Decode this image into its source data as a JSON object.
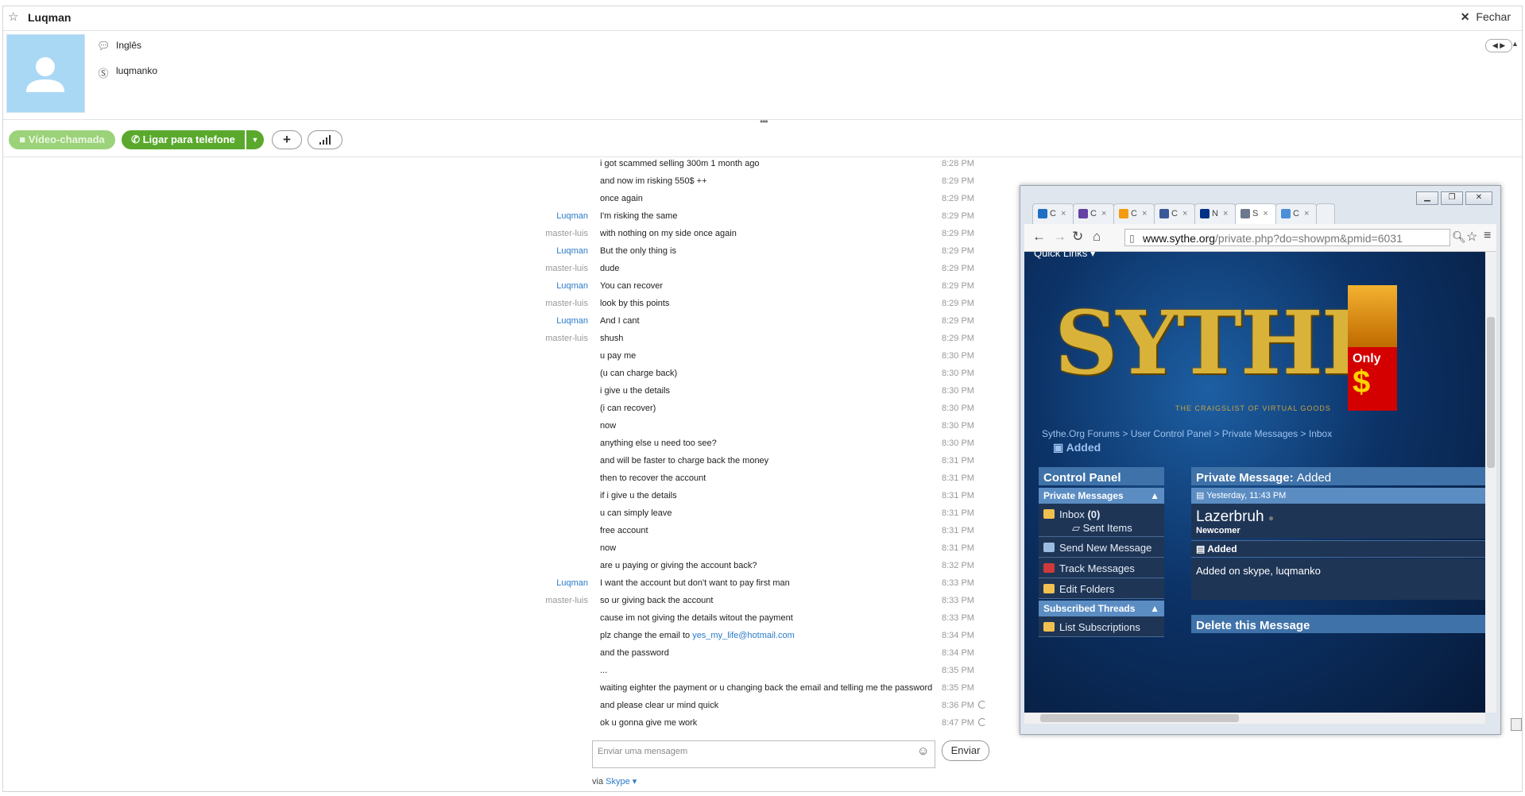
{
  "window": {
    "title": "Luqman",
    "close_label": "Fechar"
  },
  "profile": {
    "language": "Inglês",
    "skype_name": "luqmanko"
  },
  "call_bar": {
    "video_label": "Vídeo-chamada",
    "phone_label": "Ligar para telefone",
    "plus_label": "+"
  },
  "messages": [
    {
      "sender": "",
      "text": "i got scammed selling 300m 1 month ago",
      "time": "8:28 PM"
    },
    {
      "sender": "",
      "text": "and now im risking 550$ ++",
      "time": "8:29 PM"
    },
    {
      "sender": "",
      "text": "once again",
      "time": "8:29 PM"
    },
    {
      "sender": "Luqman",
      "text": "I'm risking the same",
      "time": "8:29 PM"
    },
    {
      "sender": "master-luis",
      "text": "with nothing on my side once again",
      "time": "8:29 PM"
    },
    {
      "sender": "Luqman",
      "text": "But the only thing is",
      "time": "8:29 PM"
    },
    {
      "sender": "master-luis",
      "text": "dude",
      "time": "8:29 PM"
    },
    {
      "sender": "Luqman",
      "text": "You can recover",
      "time": "8:29 PM"
    },
    {
      "sender": "master-luis",
      "text": "look by this points",
      "time": "8:29 PM"
    },
    {
      "sender": "Luqman",
      "text": "And I cant",
      "time": "8:29 PM"
    },
    {
      "sender": "master-luis",
      "text": "shush",
      "time": "8:29 PM"
    },
    {
      "sender": "",
      "text": "u pay me",
      "time": "8:30 PM"
    },
    {
      "sender": "",
      "text": "(u can charge back)",
      "time": "8:30 PM"
    },
    {
      "sender": "",
      "text": "i give u the details",
      "time": "8:30 PM"
    },
    {
      "sender": "",
      "text": "(i can recover)",
      "time": "8:30 PM"
    },
    {
      "sender": "",
      "text": "now",
      "time": "8:30 PM"
    },
    {
      "sender": "",
      "text": "anything else u need too  see?",
      "time": "8:30 PM"
    },
    {
      "sender": "",
      "text": "and will be faster to charge back the money",
      "time": "8:31 PM"
    },
    {
      "sender": "",
      "text": "then to recover the account",
      "time": "8:31 PM"
    },
    {
      "sender": "",
      "text": "if i give u the details",
      "time": "8:31 PM"
    },
    {
      "sender": "",
      "text": "u can simply leave",
      "time": "8:31 PM"
    },
    {
      "sender": "",
      "text": "free account",
      "time": "8:31 PM"
    },
    {
      "sender": "",
      "text": "now",
      "time": "8:31 PM"
    },
    {
      "sender": "",
      "text": "are u paying or giving the account back?",
      "time": "8:32 PM"
    },
    {
      "sender": "Luqman",
      "text": "I want the account but don't want to pay first man",
      "time": "8:33 PM"
    },
    {
      "sender": "master-luis",
      "text": "so ur giving back the account",
      "time": "8:33 PM"
    },
    {
      "sender": "",
      "text": "cause im not giving the details witout the payment",
      "time": "8:33 PM"
    },
    {
      "sender": "",
      "text": "plz change the email to ",
      "link": "yes_my_life@hotmail.com",
      "time": "8:34 PM"
    },
    {
      "sender": "",
      "text": "and the password",
      "time": "8:34 PM"
    },
    {
      "sender": "",
      "text": "...",
      "time": "8:35 PM"
    },
    {
      "sender": "",
      "text": "waiting eighter the payment or u changing back the email and telling me the password",
      "time": "8:35 PM"
    },
    {
      "sender": "",
      "text": "and please clear ur mind quick",
      "time": "8:36 PM",
      "pending": true
    },
    {
      "sender": "",
      "text": "ok u gonna give me work",
      "time": "8:47 PM",
      "pending": true
    }
  ],
  "composer": {
    "placeholder": "Enviar uma mensagem",
    "send_label": "Enviar",
    "via_label": "via",
    "via_link": "Skype"
  },
  "browser": {
    "tabs": [
      {
        "letter": "C",
        "color": "#1f6fc5"
      },
      {
        "letter": "C",
        "color": "#6441a5"
      },
      {
        "letter": "C",
        "color": "#f39c12"
      },
      {
        "letter": "C",
        "color": "#3b5998"
      },
      {
        "letter": "N",
        "color": "#003087"
      },
      {
        "letter": "S",
        "color": "#6a7a8c"
      },
      {
        "letter": "C",
        "color": "#4a8fd8"
      }
    ],
    "url_domain": "www.sythe.org",
    "url_path": "/private.php?do=showpm&pmid=6031",
    "site": {
      "quick_links": "Quick Links",
      "logo_text": "SYTHE",
      "tagline": "THE CRAIGSLIST OF VIRTUAL GOODS",
      "breadcrumb": [
        "Sythe.Org Forums",
        "User Control Panel",
        "Private Messages",
        "Inbox"
      ],
      "page_title": "Added",
      "ad_text": "Only",
      "ad_symbol": "$",
      "control_panel": "Control Panel",
      "private_messages": "Private Messages",
      "inbox": "Inbox",
      "inbox_count": "(0)",
      "sent_items": "Sent Items",
      "send_new": "Send New Message",
      "track": "Track Messages",
      "edit_folders": "Edit Folders",
      "subscribed": "Subscribed Threads",
      "list_subs": "List Subscriptions",
      "pm_header": "Private Message",
      "pm_header_title": "Added",
      "pm_date": "Yesterday, 11:43 PM",
      "pm_user": "Lazerbruh",
      "pm_rank": "Newcomer",
      "pm_title": "Added",
      "pm_body": "Added on skype, luqmanko",
      "delete_label": "Delete this Message"
    }
  }
}
